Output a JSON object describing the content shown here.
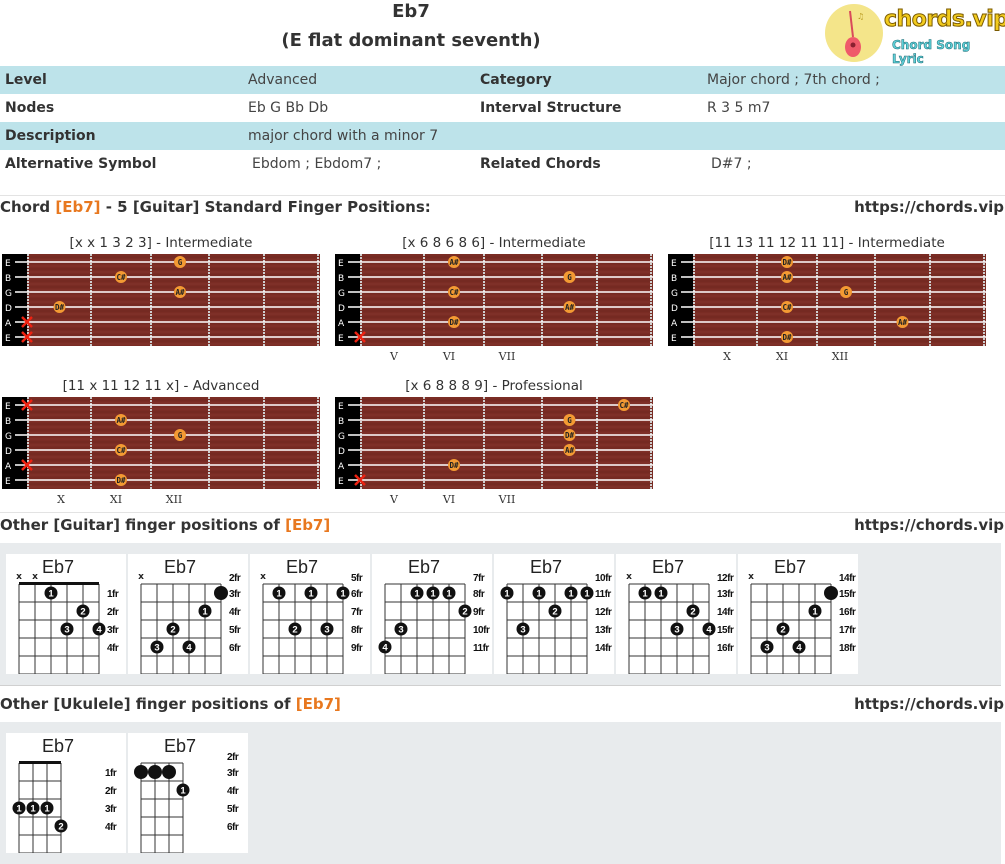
{
  "header": {
    "chord": "Eb7",
    "full_name": "(E flat dominant seventh)",
    "logo_brand": "chords.vip",
    "logo_tagline": "Chord Song Lyric"
  },
  "info": {
    "level_label": "Level",
    "level": "Advanced",
    "category_label": "Category",
    "category": "Major chord ; 7th chord ;",
    "nodes_label": "Nodes",
    "nodes": "Eb G Bb Db",
    "interval_label": "Interval Structure",
    "interval": "R 3 5 m7",
    "description_label": "Description",
    "description": "major chord with a minor 7",
    "alt_label": "Alternative Symbol",
    "alt": "Ebdom ; Ebdom7 ;",
    "related_label": "Related Chords",
    "related": "D#7 ;"
  },
  "standard": {
    "prefix": "Chord ",
    "chord": "[Eb7]",
    "suffix": " - 5 [Guitar] Standard Finger Positions:",
    "url": "https://chords.vip"
  },
  "string_names": [
    "E",
    "B",
    "G",
    "D",
    "A",
    "E"
  ],
  "fretboards": [
    {
      "caption": "[x x 1 3 2 3] - Intermediate",
      "roman": [],
      "muted": [
        4,
        5
      ],
      "notes": [
        {
          "s": 0,
          "f": 3,
          "n": "G"
        },
        {
          "s": 1,
          "f": 2,
          "n": "C#"
        },
        {
          "s": 2,
          "f": 3,
          "n": "A#"
        },
        {
          "s": 3,
          "f": 1,
          "n": "D#"
        }
      ]
    },
    {
      "caption": "[x 6 8 6 8 6] - Intermediate",
      "roman": [
        "V",
        "VI",
        "VII"
      ],
      "muted": [
        5
      ],
      "notes": [
        {
          "s": 0,
          "f": 2,
          "n": "A#"
        },
        {
          "s": 1,
          "f": 4,
          "n": "G"
        },
        {
          "s": 2,
          "f": 2,
          "n": "C#"
        },
        {
          "s": 3,
          "f": 4,
          "n": "A#"
        },
        {
          "s": 4,
          "f": 2,
          "n": "D#"
        }
      ]
    },
    {
      "caption": "[11 13 11 12 11 11] - Intermediate",
      "roman": [
        "X",
        "XI",
        "XII"
      ],
      "muted": [],
      "notes": [
        {
          "s": 0,
          "f": 2,
          "n": "D#"
        },
        {
          "s": 1,
          "f": 2,
          "n": "A#"
        },
        {
          "s": 2,
          "f": 3,
          "n": "G"
        },
        {
          "s": 3,
          "f": 2,
          "n": "C#"
        },
        {
          "s": 4,
          "f": 4,
          "n": "A#"
        },
        {
          "s": 5,
          "f": 2,
          "n": "D#"
        }
      ]
    },
    {
      "caption": "[11 x 11 12 11 x] - Advanced",
      "roman": [
        "X",
        "XI",
        "XII"
      ],
      "muted": [
        0,
        4
      ],
      "notes": [
        {
          "s": 1,
          "f": 2,
          "n": "A#"
        },
        {
          "s": 2,
          "f": 3,
          "n": "G"
        },
        {
          "s": 3,
          "f": 2,
          "n": "C#"
        },
        {
          "s": 5,
          "f": 2,
          "n": "D#"
        }
      ]
    },
    {
      "caption": "[x 6 8 8 8 9] - Professional",
      "roman": [
        "V",
        "VI",
        "VII"
      ],
      "muted": [
        5
      ],
      "notes": [
        {
          "s": 0,
          "f": 5,
          "n": "C#"
        },
        {
          "s": 1,
          "f": 4,
          "n": "G"
        },
        {
          "s": 2,
          "f": 4,
          "n": "D#"
        },
        {
          "s": 3,
          "f": 4,
          "n": "A#"
        },
        {
          "s": 4,
          "f": 2,
          "n": "D#"
        }
      ]
    }
  ],
  "guitar_section": {
    "prefix": "Other [Guitar] finger positions of ",
    "chord": "[Eb7]",
    "url": "https://chords.vip"
  },
  "guitar_diagrams": [
    {
      "name": "Eb7",
      "nut": true,
      "frets": [
        "1fr",
        "2fr",
        "3fr",
        "4fr"
      ],
      "fret_label_row0": false,
      "x": [
        0,
        1
      ],
      "dots": [
        {
          "s": 2,
          "r": 1,
          "t": "1"
        },
        {
          "s": 4,
          "r": 2,
          "t": "2"
        },
        {
          "s": 3,
          "r": 3,
          "t": "3"
        },
        {
          "s": 5,
          "r": 3,
          "t": "4"
        }
      ]
    },
    {
      "name": "Eb7",
      "nut": false,
      "frets": [
        "2fr",
        "3fr",
        "4fr",
        "5fr",
        "6fr"
      ],
      "fret_label_row0": true,
      "x": [
        0
      ],
      "dots": [
        {
          "s": 5,
          "r": 1,
          "t": ""
        },
        {
          "s": 4,
          "r": 2,
          "t": "1"
        },
        {
          "s": 2,
          "r": 3,
          "t": "2"
        },
        {
          "s": 1,
          "r": 4,
          "t": "3"
        },
        {
          "s": 3,
          "r": 4,
          "t": "4"
        }
      ]
    },
    {
      "name": "Eb7",
      "nut": false,
      "frets": [
        "5fr",
        "6fr",
        "7fr",
        "8fr",
        "9fr"
      ],
      "fret_label_row0": true,
      "x": [
        0
      ],
      "dots": [
        {
          "s": 1,
          "r": 1,
          "t": "1"
        },
        {
          "s": 3,
          "r": 1,
          "t": "1"
        },
        {
          "s": 5,
          "r": 1,
          "t": "1"
        },
        {
          "s": 2,
          "r": 3,
          "t": "2"
        },
        {
          "s": 4,
          "r": 3,
          "t": "3"
        }
      ]
    },
    {
      "name": "Eb7",
      "nut": false,
      "frets": [
        "7fr",
        "8fr",
        "9fr",
        "10fr",
        "11fr"
      ],
      "fret_label_row0": true,
      "x": [],
      "dots": [
        {
          "s": 2,
          "r": 1,
          "t": "1"
        },
        {
          "s": 3,
          "r": 1,
          "t": "1"
        },
        {
          "s": 4,
          "r": 1,
          "t": "1"
        },
        {
          "s": 5,
          "r": 2,
          "t": "2"
        },
        {
          "s": 1,
          "r": 3,
          "t": "3"
        },
        {
          "s": 0,
          "r": 4,
          "t": "4"
        }
      ]
    },
    {
      "name": "Eb7",
      "nut": false,
      "frets": [
        "10fr",
        "11fr",
        "12fr",
        "13fr",
        "14fr"
      ],
      "fret_label_row0": true,
      "x": [],
      "dots": [
        {
          "s": 0,
          "r": 1,
          "t": "1"
        },
        {
          "s": 2,
          "r": 1,
          "t": "1"
        },
        {
          "s": 4,
          "r": 1,
          "t": "1"
        },
        {
          "s": 5,
          "r": 1,
          "t": "1"
        },
        {
          "s": 3,
          "r": 2,
          "t": "2"
        },
        {
          "s": 1,
          "r": 3,
          "t": "3"
        }
      ]
    },
    {
      "name": "Eb7",
      "nut": false,
      "frets": [
        "12fr",
        "13fr",
        "14fr",
        "15fr",
        "16fr"
      ],
      "fret_label_row0": true,
      "x": [
        0
      ],
      "dots": [
        {
          "s": 1,
          "r": 1,
          "t": "1"
        },
        {
          "s": 2,
          "r": 1,
          "t": "1"
        },
        {
          "s": 4,
          "r": 2,
          "t": "2"
        },
        {
          "s": 3,
          "r": 3,
          "t": "3"
        },
        {
          "s": 5,
          "r": 3,
          "t": "4"
        }
      ]
    },
    {
      "name": "Eb7",
      "nut": false,
      "frets": [
        "14fr",
        "15fr",
        "16fr",
        "17fr",
        "18fr"
      ],
      "fret_label_row0": true,
      "x": [
        0
      ],
      "dots": [
        {
          "s": 5,
          "r": 1,
          "t": ""
        },
        {
          "s": 4,
          "r": 2,
          "t": "1"
        },
        {
          "s": 2,
          "r": 3,
          "t": "2"
        },
        {
          "s": 1,
          "r": 4,
          "t": "3"
        },
        {
          "s": 3,
          "r": 4,
          "t": "4"
        }
      ]
    }
  ],
  "ukulele_section": {
    "prefix": "Other [Ukulele] finger positions of ",
    "chord": "[Eb7]",
    "url": "https://chords.vip"
  },
  "ukulele_diagrams": [
    {
      "name": "Eb7",
      "nut": true,
      "frets": [
        "1fr",
        "2fr",
        "3fr",
        "4fr"
      ],
      "fret_label_row0": false,
      "dots": [
        {
          "s": 0,
          "r": 3,
          "t": "1"
        },
        {
          "s": 1,
          "r": 3,
          "t": "1"
        },
        {
          "s": 2,
          "r": 3,
          "t": "1"
        },
        {
          "s": 3,
          "r": 4,
          "t": "2"
        }
      ]
    },
    {
      "name": "Eb7",
      "nut": false,
      "frets": [
        "2fr",
        "3fr",
        "4fr",
        "5fr",
        "6fr"
      ],
      "fret_label_row0": true,
      "dots": [
        {
          "s": 0,
          "r": 1,
          "t": ""
        },
        {
          "s": 1,
          "r": 1,
          "t": ""
        },
        {
          "s": 2,
          "r": 1,
          "t": ""
        },
        {
          "s": 3,
          "r": 2,
          "t": "1"
        }
      ]
    }
  ]
}
